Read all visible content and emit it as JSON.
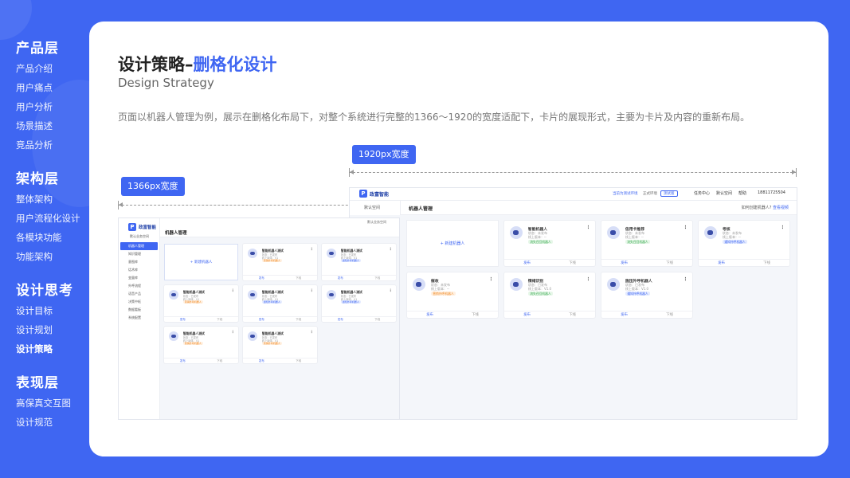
{
  "nav": [
    {
      "title": "产品层",
      "items": [
        "产品介绍",
        "用户痛点",
        "用户分析",
        "场景描述",
        "竞品分析"
      ]
    },
    {
      "title": "架构层",
      "items": [
        "整体架构",
        "用户流程化设计",
        "各模块功能",
        "功能架构"
      ]
    },
    {
      "title": "设计思考",
      "items": [
        "设计目标",
        "设计规划",
        "设计策略"
      ]
    },
    {
      "title": "表现层",
      "items": [
        "高保真交互图",
        "设计规范"
      ]
    }
  ],
  "active_nav": "设计策略",
  "heading": {
    "title_prefix": "设计策略–",
    "title_highlight": "删格化设计",
    "subtitle": "Design Strategy"
  },
  "description": "页面以机器人管理为例，展示在删格化布局下，对整个系统进行完整的1366～1920的宽度适配下，卡片的展现形式，主要为卡片及内容的重新布局。",
  "tags": {
    "w1920": "1920px宽度",
    "w1366": "1366px宽度"
  },
  "small_mock": {
    "logo": "政富智能",
    "space": "默认业务空间",
    "page_title": "机器人管理",
    "menu": [
      {
        "label": "机器人管理",
        "active": true
      },
      {
        "label": "知识管理",
        "active": false
      },
      {
        "label": "意图库",
        "active": false
      },
      {
        "label": "话术库",
        "active": false
      },
      {
        "label": "变量库",
        "active": false
      },
      {
        "label": "外呼流程",
        "active": false
      },
      {
        "label": "语音产品",
        "active": false
      },
      {
        "label": "决策中枢",
        "active": false
      },
      {
        "label": "数据看板",
        "active": false
      },
      {
        "label": "系统配置",
        "active": false
      }
    ],
    "add_label": "+ 新建机器人",
    "cards": [
      {
        "name": "智能机器人测试",
        "meta1": "状态：已发布",
        "meta2": "线上版本：V1",
        "badge": "营销外呼机器人",
        "badge_color": "orange"
      },
      {
        "name": "智能机器人测试",
        "meta1": "状态：已发布",
        "meta2": "线上版本：V1",
        "badge": "通知外呼机器人",
        "badge_color": "blue"
      },
      {
        "name": "智能机器人测试",
        "meta1": "状态：已发布",
        "meta2": "线上版本：V1",
        "badge": "营销外呼机器人",
        "badge_color": "orange"
      },
      {
        "name": "智能机器人测试",
        "meta1": "状态：已发布",
        "meta2": "线上版本：V1",
        "badge": "通知外呼机器人",
        "badge_color": "blue"
      },
      {
        "name": "智能机器人测试",
        "meta1": "状态：已发布",
        "meta2": "线上版本：V1",
        "badge": "通知外呼机器人",
        "badge_color": "blue"
      },
      {
        "name": "智能机器人测试",
        "meta1": "状态：已发布",
        "meta2": "线上版本：V1",
        "badge": "营销外呼机器人",
        "badge_color": "orange"
      },
      {
        "name": "智能机器人测试",
        "meta1": "状态：已发布",
        "meta2": "线上版本：V1",
        "badge": "营销外呼机器人",
        "badge_color": "orange"
      }
    ],
    "publish": "发布",
    "offline": "下线"
  },
  "large_mock": {
    "space": "默认空间",
    "page_title": "机器人管理",
    "top_links": [
      "任务中心",
      "默认空间",
      "帮助"
    ],
    "phone": "18811725504",
    "top_hint": "当前为测试环境",
    "env": "正式环境",
    "btn": "测试版",
    "help_link": "如何创建机器人?",
    "help_action": "查看视频",
    "add_label": "+ 新建机器人",
    "cards": [
      {
        "name": "智能机器人",
        "meta1": "状态：未发布",
        "meta2": "线上版本：--",
        "badge": "流失召回机器人",
        "badge_color": "green"
      },
      {
        "name": "信用卡推荐",
        "meta1": "状态：未发布",
        "meta2": "线上版本：--",
        "badge": "流失召回机器人",
        "badge_color": "green"
      },
      {
        "name": "考核",
        "meta1": "状态：未发布",
        "meta2": "线上版本：--",
        "badge": "通知外呼机器人",
        "badge_color": "blue"
      },
      {
        "name": "催收",
        "meta1": "状态：未发布",
        "meta2": "线上版本：--",
        "badge": "营销外呼机器人",
        "badge_color": "orange"
      },
      {
        "name": "情绪识别",
        "meta1": "状态：已发布",
        "meta2": "线上版本：V1.0",
        "badge": "流失召回机器人",
        "badge_color": "green"
      },
      {
        "name": "施压外呼机器人",
        "meta1": "状态：已发布",
        "meta2": "线上版本：V1.0",
        "badge": "通知外呼机器人",
        "badge_color": "blue"
      }
    ],
    "publish": "发布",
    "offline": "下线"
  },
  "colors": {
    "brand": "#3f66f2",
    "green": "#3bab52",
    "orange": "#f08a24"
  }
}
